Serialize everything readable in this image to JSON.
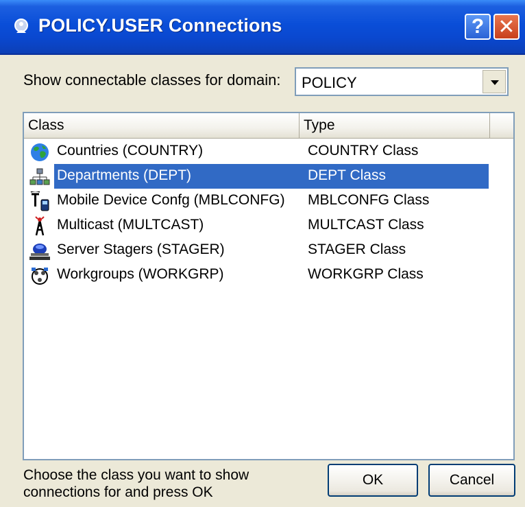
{
  "window": {
    "title": "POLICY.USER Connections",
    "help_label": "?",
    "close_label": "✕"
  },
  "domain": {
    "label": "Show connectable classes for domain:",
    "selected": "POLICY"
  },
  "list": {
    "columns": [
      "Class",
      "Type"
    ],
    "rows": [
      {
        "name": "Countries (COUNTRY)",
        "type": "COUNTRY Class",
        "icon": "globe-icon"
      },
      {
        "name": "Departments (DEPT)",
        "type": "DEPT Class",
        "icon": "org-chart-icon",
        "selected": true
      },
      {
        "name": "Mobile Device Confg (MBLCONFG)",
        "type": "MBLCONFG Class",
        "icon": "mobile-device-icon"
      },
      {
        "name": "Multicast (MULTCAST)",
        "type": "MULTCAST Class",
        "icon": "antenna-icon"
      },
      {
        "name": "Server Stagers (STAGER)",
        "type": "STAGER Class",
        "icon": "server-stager-icon"
      },
      {
        "name": "Workgroups (WORKGRP)",
        "type": "WORKGRP Class",
        "icon": "workgroup-icon"
      }
    ]
  },
  "footer": {
    "hint": "Choose the class you want to show connections for and press OK",
    "ok_label": "OK",
    "cancel_label": "Cancel"
  },
  "colors": {
    "titlebar": "#0a4ed8",
    "selection": "#316ac5",
    "dialog_bg": "#ece9d8"
  }
}
